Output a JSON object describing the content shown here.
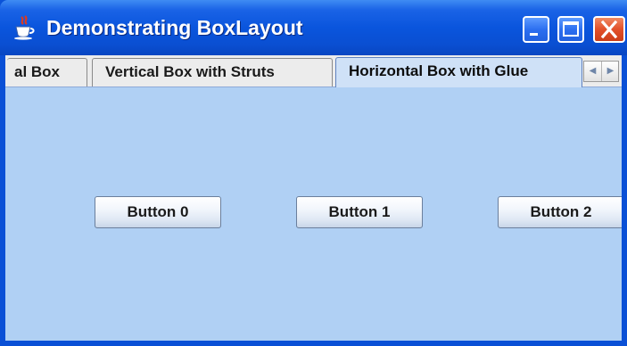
{
  "window": {
    "title": "Demonstrating BoxLayout",
    "icon": "java-cup-icon",
    "controls": {
      "minimize": "minimize-icon",
      "maximize": "maximize-icon",
      "close": "close-icon"
    }
  },
  "tabs": [
    {
      "label": "al Box",
      "selected": false
    },
    {
      "label": "Vertical Box with Struts",
      "selected": false
    },
    {
      "label": "Horizontal Box with Glue",
      "selected": true
    }
  ],
  "tab_scroll": {
    "left": "◀",
    "right": "▶"
  },
  "panel": {
    "buttons": [
      {
        "label": "Button 0"
      },
      {
        "label": "Button 1"
      },
      {
        "label": "Button 2"
      }
    ]
  },
  "colors": {
    "titlebar": "#0a55dd",
    "panel_background": "#b0d0f4",
    "close_button": "#e2502a"
  }
}
